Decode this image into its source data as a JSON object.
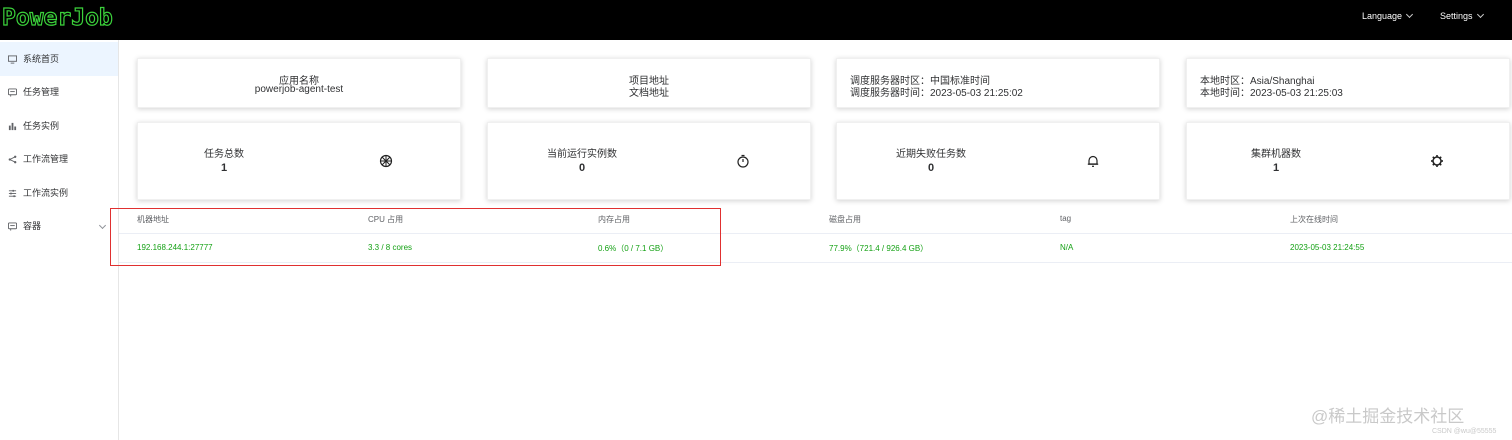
{
  "header": {
    "logo_text": "PowerJob",
    "language_label": "Language",
    "settings_label": "Settings"
  },
  "sidebar": {
    "items": [
      {
        "label": "系统首页",
        "icon": "monitor-icon"
      },
      {
        "label": "任务管理",
        "icon": "task-icon"
      },
      {
        "label": "任务实例",
        "icon": "bar-chart-icon"
      },
      {
        "label": "工作流管理",
        "icon": "share-icon"
      },
      {
        "label": "工作流实例",
        "icon": "sliders-icon"
      },
      {
        "label": "容器",
        "icon": "container-icon"
      }
    ]
  },
  "info_cards": {
    "app": {
      "title": "应用名称",
      "value": "powerjob-agent-test"
    },
    "project": {
      "line1": "项目地址",
      "line2": "文档地址"
    },
    "server": {
      "line1": "调度服务器时区：中国标准时间",
      "line2": "调度服务器时间：2023-05-03 21:25:02"
    },
    "local": {
      "line1": "本地时区：Asia/Shanghai",
      "line2": "本地时间：2023-05-03 21:25:03"
    }
  },
  "stats": [
    {
      "title": "任务总数",
      "value": "1",
      "icon": "dharma-wheel-icon"
    },
    {
      "title": "当前运行实例数",
      "value": "0",
      "icon": "stopwatch-icon"
    },
    {
      "title": "近期失败任务数",
      "value": "0",
      "icon": "bell-icon"
    },
    {
      "title": "集群机器数",
      "value": "1",
      "icon": "cog-icon"
    }
  ],
  "table": {
    "headers": [
      "机器地址",
      "CPU 占用",
      "内存占用",
      "磁盘占用",
      "tag",
      "上次在线时间"
    ],
    "rows": [
      [
        "192.168.244.1:27777",
        "3.3 / 8 cores",
        "0.6%（0 / 7.1 GB）",
        "77.9%（721.4 / 926.4 GB）",
        "N/A",
        "2023-05-03 21:24:55"
      ]
    ]
  },
  "colors": {
    "accent": "#14a114",
    "highlight_box": "#e03030",
    "header_bg": "#000000"
  },
  "watermark": {
    "main": "@稀土掘金技术社区",
    "sub": "CSDN @wu@55555"
  }
}
